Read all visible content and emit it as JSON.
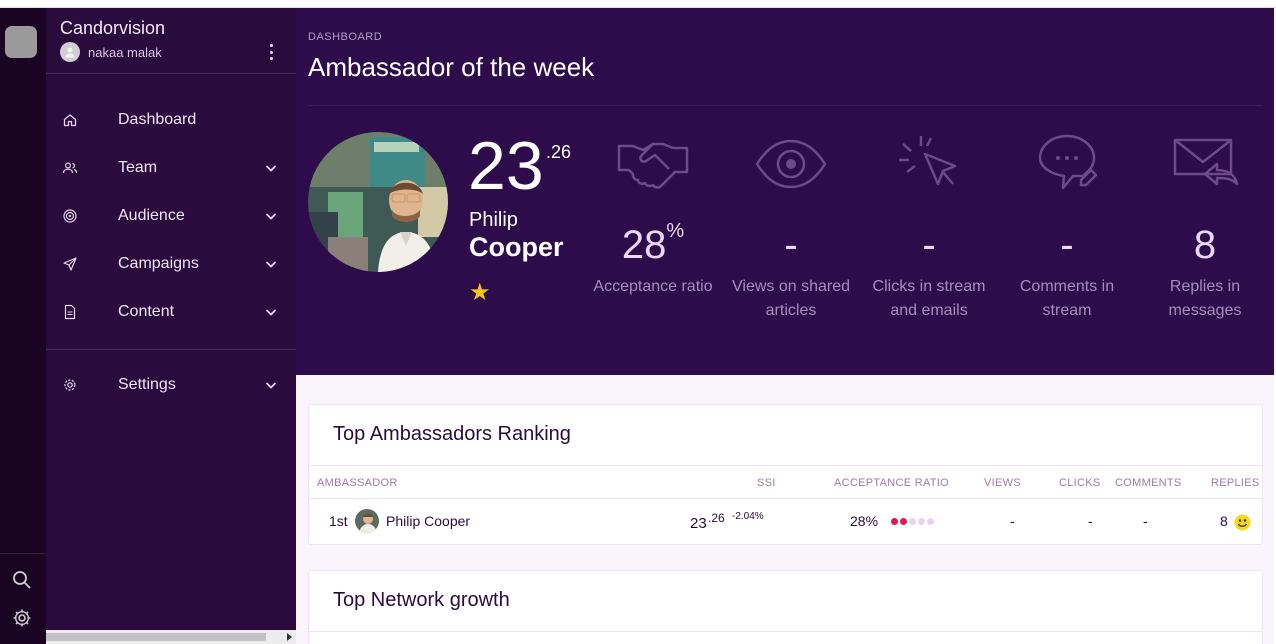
{
  "rail": {
    "search_icon": "search-icon",
    "settings_icon": "gear-icon"
  },
  "sidebar": {
    "brand": "Candorvision",
    "user_name": "nakaa malak",
    "items": [
      {
        "label": "Dashboard",
        "icon": "home-icon"
      },
      {
        "label": "Team",
        "icon": "users-icon"
      },
      {
        "label": "Audience",
        "icon": "target-icon"
      },
      {
        "label": "Campaigns",
        "icon": "paper-plane-icon"
      },
      {
        "label": "Content",
        "icon": "document-icon"
      },
      {
        "label": "Settings",
        "icon": "gear-icon"
      }
    ]
  },
  "header": {
    "breadcrumb": "DASHBOARD",
    "title": "Ambassador of the week"
  },
  "ambassador": {
    "score_int": "23",
    "score_dec": ".26",
    "first_name": "Philip",
    "last_name": "Cooper",
    "star": "★"
  },
  "metrics": [
    {
      "value": "28",
      "unit": "%",
      "label_1": "Acceptance ratio",
      "label_2": "",
      "icon": "handshake-icon"
    },
    {
      "value": "-",
      "unit": "",
      "label_1": "Views on shared",
      "label_2": "articles",
      "icon": "eye-icon"
    },
    {
      "value": "-",
      "unit": "",
      "label_1": "Clicks in stream",
      "label_2": "and emails",
      "icon": "cursor-click-icon"
    },
    {
      "value": "-",
      "unit": "",
      "label_1": "Comments in",
      "label_2": "stream",
      "icon": "comment-icon"
    },
    {
      "value": "8",
      "unit": "",
      "label_1": "Replies in",
      "label_2": "messages",
      "icon": "mail-reply-icon"
    }
  ],
  "ranking": {
    "title": "Top Ambassadors Ranking",
    "columns": [
      "AMBASSADOR",
      "SSI",
      "ACCEPTANCE RATIO",
      "VIEWS",
      "CLICKS",
      "COMMENTS",
      "REPLIES"
    ],
    "rows": [
      {
        "rank": "1st",
        "name": "Philip Cooper",
        "ssi_int": "23",
        "ssi_dec": ".26",
        "ssi_change": "-2.04%",
        "acceptance": "28%",
        "acceptance_level": 2,
        "acceptance_max": 5,
        "views": "-",
        "clicks": "-",
        "comments": "-",
        "replies": "8"
      }
    ]
  },
  "network": {
    "title": "Top Network growth"
  },
  "colors": {
    "accent_red": "#e0194f",
    "dot_empty": "#e6d3ec",
    "star": "#f7c61a"
  }
}
